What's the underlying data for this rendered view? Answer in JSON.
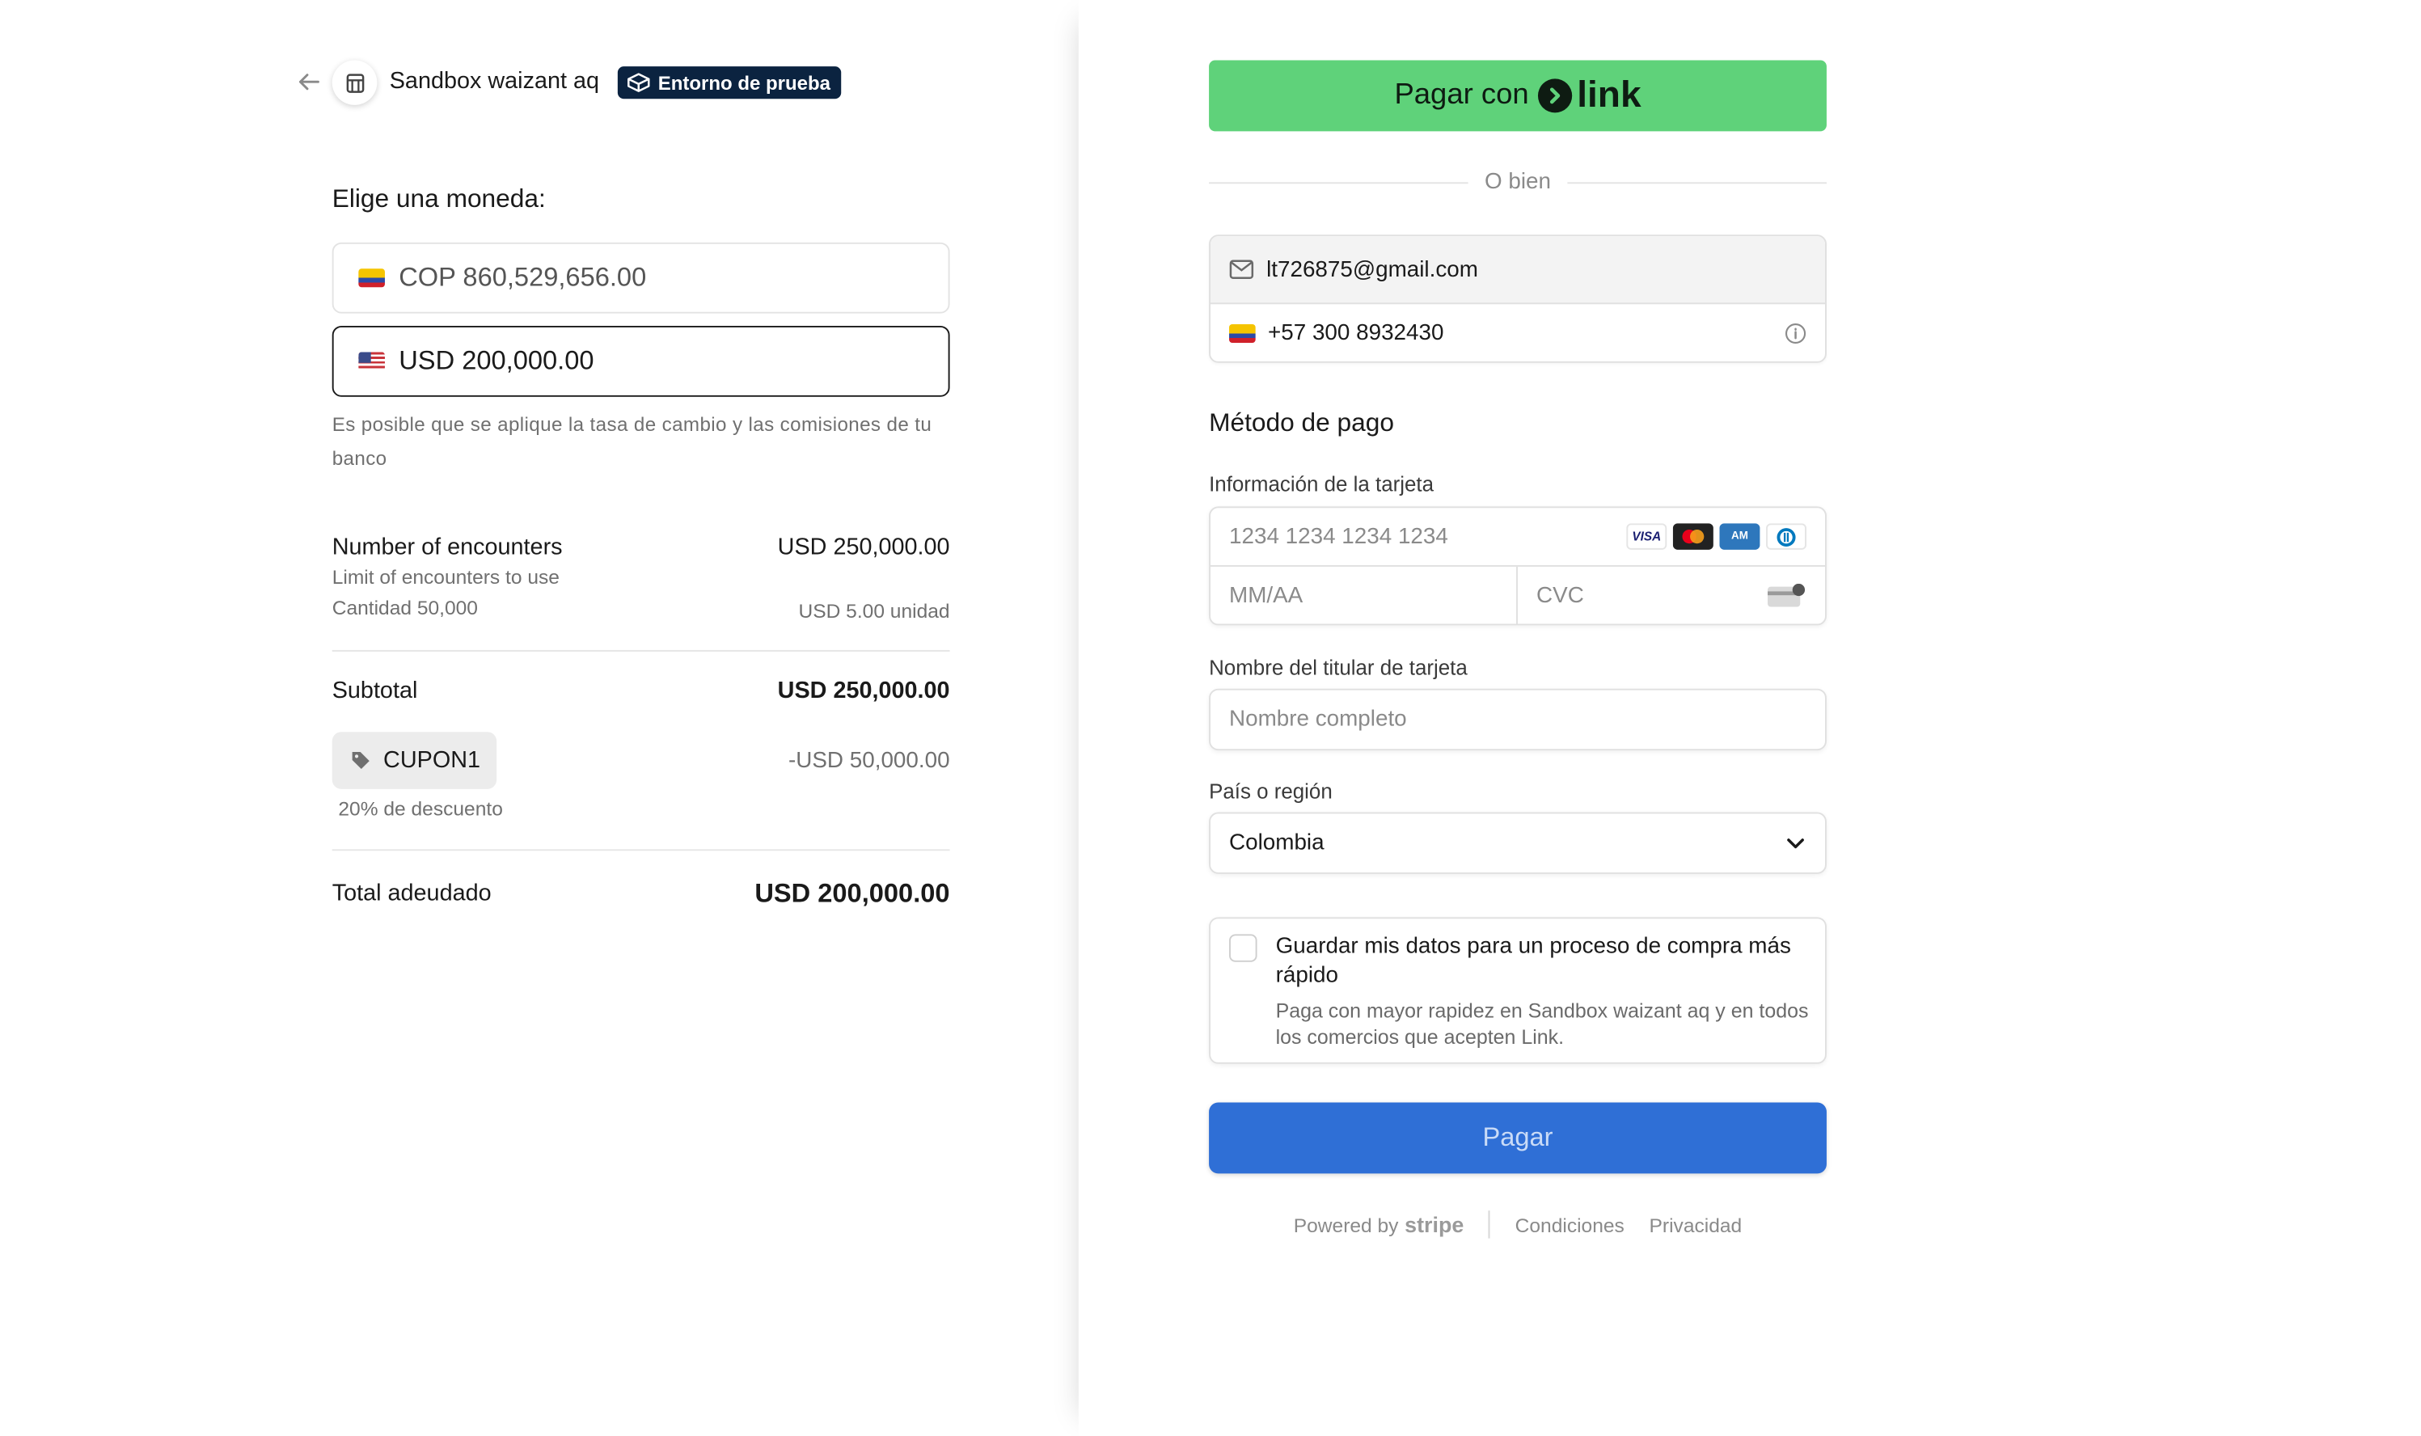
{
  "header": {
    "merchant_name": "Sandbox waizant aq",
    "test_badge": "Entorno de prueba"
  },
  "currency": {
    "title": "Elige una moneda:",
    "options": [
      {
        "code": "COP",
        "label": "COP 860,529,656.00",
        "selected": false
      },
      {
        "code": "USD",
        "label": "USD 200,000.00",
        "selected": true
      }
    ],
    "note": "Es posible que se aplique la tasa de cambio y las comisiones de tu banco"
  },
  "summary": {
    "item": {
      "name": "Number of encounters",
      "description": "Limit of encounters to use",
      "quantity": "Cantidad 50,000",
      "price": "USD 250,000.00",
      "unit_price": "USD 5.00 unidad"
    },
    "subtotal_label": "Subtotal",
    "subtotal_value": "USD 250,000.00",
    "coupon_code": "CUPON1",
    "coupon_value": "-USD 50,000.00",
    "coupon_desc": "20% de descuento",
    "total_label": "Total adeudado",
    "total_value": "USD 200,000.00"
  },
  "payment": {
    "link_button_prefix": "Pagar con",
    "link_logo_text": "link",
    "or_text": "O bien",
    "email": "lt726875@gmail.com",
    "phone": "+57 300 8932430",
    "method_title": "Método de pago",
    "card_label": "Información de la tarjeta",
    "card_number_placeholder": "1234 1234 1234 1234",
    "expiry_placeholder": "MM/AA",
    "cvc_placeholder": "CVC",
    "card_brands": [
      "VISA",
      "Mastercard",
      "American Express",
      "Diners Club"
    ],
    "name_label": "Nombre del titular de tarjeta",
    "name_placeholder": "Nombre completo",
    "country_label": "País o región",
    "country_value": "Colombia",
    "save_title": "Guardar mis datos para un proceso de compra más rápido",
    "save_desc": "Paga con mayor rapidez en Sandbox waizant aq y en todos los comercios que acepten Link.",
    "pay_button": "Pagar"
  },
  "footer": {
    "powered_by": "Powered by",
    "stripe": "stripe",
    "terms": "Condiciones",
    "privacy": "Privacidad"
  },
  "colors": {
    "link_green": "#5fd27a",
    "pay_blue": "#2f6fd6",
    "test_badge_bg": "#0b2340"
  }
}
